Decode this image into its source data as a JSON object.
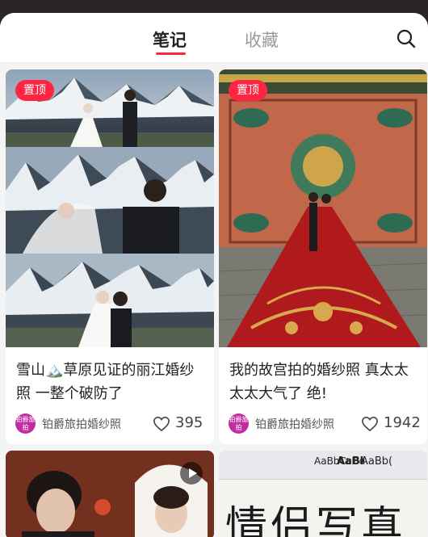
{
  "tabs": {
    "notes": "笔记",
    "favorites": "收藏"
  },
  "icons": {
    "search": "search-icon",
    "like": "heart-icon",
    "play": "play-icon"
  },
  "colors": {
    "accent": "#ff2442",
    "avatar": "#c12da0"
  },
  "cards": [
    {
      "badge": "置顶",
      "title": "雪山🏔️草原见证的丽江婚纱照 一整个破防了",
      "author": "铂爵旅拍婚纱照",
      "avatar_text": "铂爵旅拍",
      "likes": "395"
    },
    {
      "badge": "置顶",
      "title": "我的故宫拍的婚纱照 真太太太太大气了 绝!",
      "author": "铂爵旅拍婚纱照",
      "avatar_text": "铂爵旅拍",
      "likes": "1942"
    }
  ],
  "bottom_right_card": {
    "ribbon": [
      "AaBbCcDd",
      "AaBl",
      "AaBb("
    ],
    "big_text": "情侣写真"
  }
}
